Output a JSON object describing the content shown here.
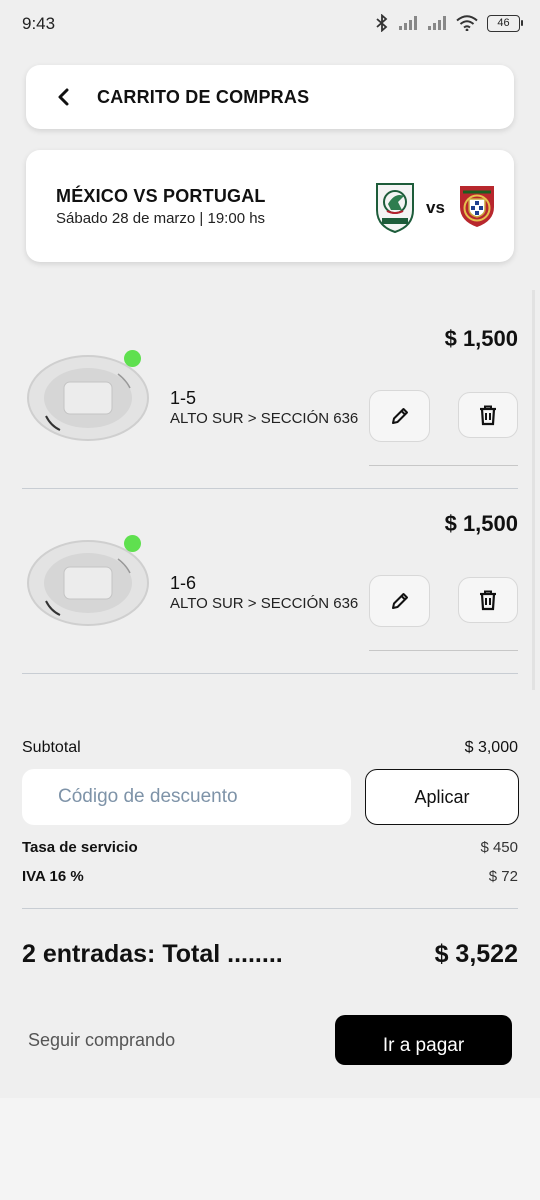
{
  "status_bar": {
    "time": "9:43",
    "battery": "46",
    "icons": [
      "bluetooth-icon",
      "signal-icon",
      "signal-icon",
      "wifi-icon",
      "battery-icon"
    ]
  },
  "header": {
    "back_icon": "chevron-left-icon",
    "title": "CARRITO DE COMPRAS"
  },
  "match": {
    "title": "MÉXICO VS PORTUGAL",
    "date": "Sábado 28 de marzo | 19:00 hs",
    "home_crest": "mexico-crest-icon",
    "vs": "vs",
    "away_crest": "portugal-crest-icon"
  },
  "tickets": [
    {
      "price": "$ 1,500",
      "seat": "1-5",
      "section": "ALTO SUR > SECCIÓN 636",
      "edit_icon": "pencil-icon",
      "delete_icon": "trash-icon",
      "status_color": "#5fe04f"
    },
    {
      "price": "$ 1,500",
      "seat": "1-6",
      "section": "ALTO SUR > SECCIÓN 636",
      "edit_icon": "pencil-icon",
      "delete_icon": "trash-icon",
      "status_color": "#5fe04f"
    }
  ],
  "summary": {
    "subtotal_label": "Subtotal",
    "subtotal_value": "$ 3,000",
    "discount_placeholder": "Código de descuento",
    "apply_label": "Aplicar",
    "service_label": "Tasa de servicio",
    "service_value": "$ 450",
    "iva_label": "IVA 16 %",
    "iva_value": "$ 72",
    "total_label": "2 entradas: Total ........",
    "total_value": "$ 3,522"
  },
  "actions": {
    "continue_label": "Seguir comprando",
    "pay_label": "Ir a pagar"
  },
  "colors": {
    "accent": "#000000",
    "status_dot": "#5fe04f",
    "background": "#efefef"
  }
}
